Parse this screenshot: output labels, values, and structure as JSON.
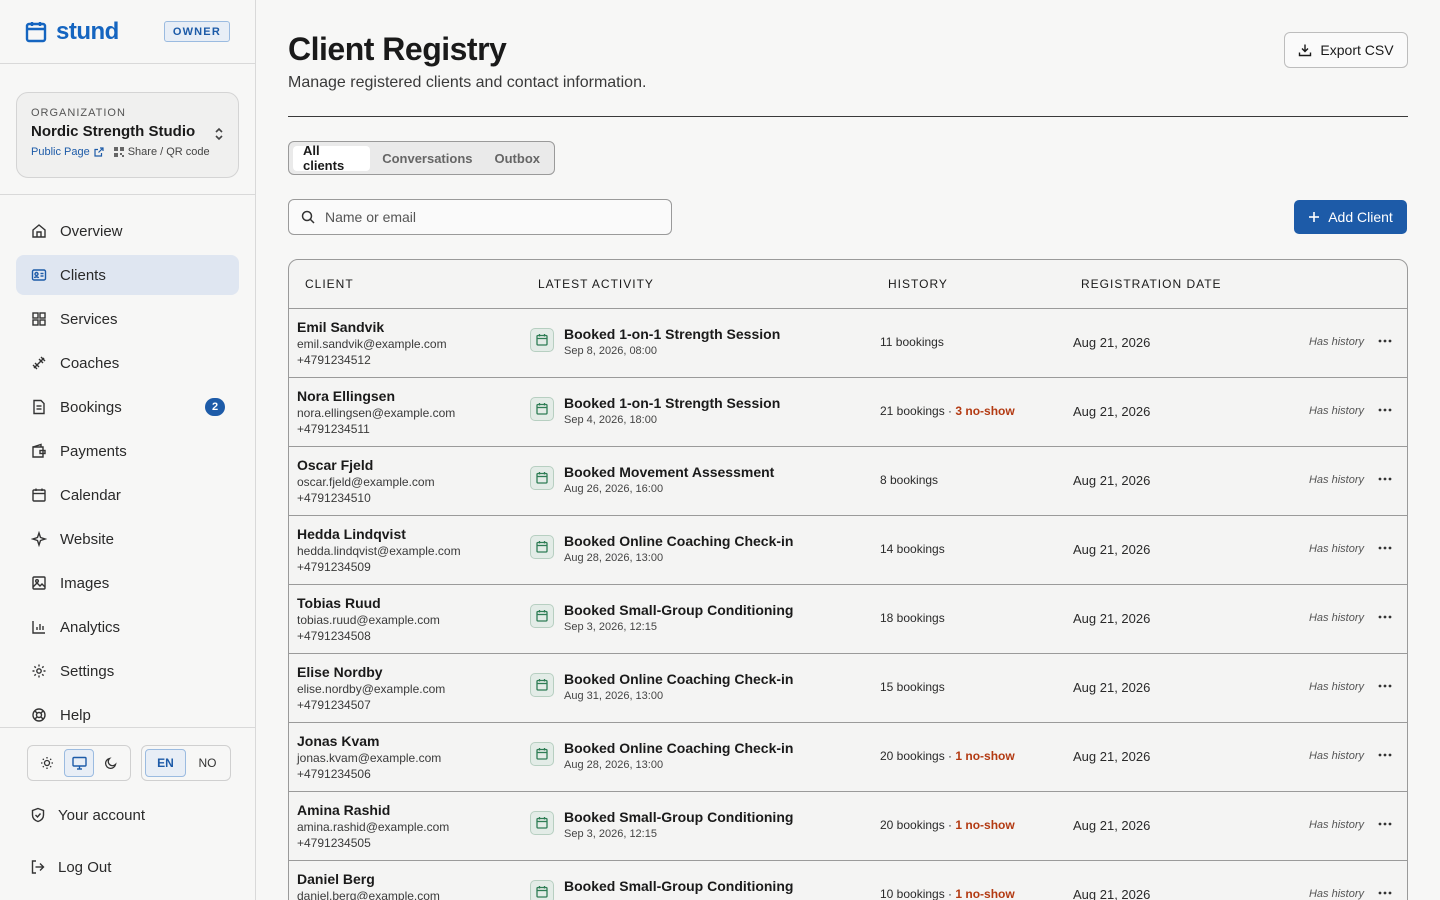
{
  "brand": {
    "name": "stund",
    "role_badge": "OWNER"
  },
  "organization": {
    "caption": "ORGANIZATION",
    "name": "Nordic Strength Studio",
    "public_page": "Public Page",
    "share": "Share / QR code"
  },
  "nav": [
    {
      "label": "Overview",
      "icon": "home-icon"
    },
    {
      "label": "Clients",
      "icon": "id-card-icon",
      "active": true
    },
    {
      "label": "Services",
      "icon": "grid-icon"
    },
    {
      "label": "Coaches",
      "icon": "dumbbell-icon"
    },
    {
      "label": "Bookings",
      "icon": "document-icon",
      "badge": "2"
    },
    {
      "label": "Payments",
      "icon": "wallet-icon"
    },
    {
      "label": "Calendar",
      "icon": "calendar-icon"
    },
    {
      "label": "Website",
      "icon": "sparkle-icon"
    },
    {
      "label": "Images",
      "icon": "image-icon"
    },
    {
      "label": "Analytics",
      "icon": "bar-chart-icon"
    },
    {
      "label": "Settings",
      "icon": "gear-icon"
    },
    {
      "label": "Help",
      "icon": "lifebuoy-icon"
    }
  ],
  "toggles": {
    "theme_active": "system",
    "lang": [
      "EN",
      "NO"
    ],
    "lang_active": "EN"
  },
  "bottom": {
    "account": "Your account",
    "logout": "Log Out"
  },
  "header": {
    "title": "Client Registry",
    "subtitle": "Manage registered clients and contact information.",
    "export": "Export CSV"
  },
  "tabs": [
    "All clients",
    "Conversations",
    "Outbox"
  ],
  "search": {
    "placeholder": "Name or email"
  },
  "add_client": "Add Client",
  "table": {
    "headers": [
      "CLIENT",
      "LATEST ACTIVITY",
      "HISTORY",
      "REGISTRATION DATE"
    ],
    "rows": [
      {
        "name": "Emil Sandvik",
        "email": "emil.sandvik@example.com",
        "phone": "+4791234512",
        "activity": "Booked 1-on-1 Strength Session",
        "time": "Sep 8, 2026, 08:00",
        "history": "11 bookings",
        "noshow": "",
        "date": "Aug 21, 2026",
        "status": "Has history"
      },
      {
        "name": "Nora Ellingsen",
        "email": "nora.ellingsen@example.com",
        "phone": "+4791234511",
        "activity": "Booked 1-on-1 Strength Session",
        "time": "Sep 4, 2026, 18:00",
        "history": "21 bookings",
        "noshow": "3 no-show",
        "date": "Aug 21, 2026",
        "status": "Has history"
      },
      {
        "name": "Oscar Fjeld",
        "email": "oscar.fjeld@example.com",
        "phone": "+4791234510",
        "activity": "Booked Movement Assessment",
        "time": "Aug 26, 2026, 16:00",
        "history": "8 bookings",
        "noshow": "",
        "date": "Aug 21, 2026",
        "status": "Has history"
      },
      {
        "name": "Hedda Lindqvist",
        "email": "hedda.lindqvist@example.com",
        "phone": "+4791234509",
        "activity": "Booked Online Coaching Check-in",
        "time": "Aug 28, 2026, 13:00",
        "history": "14 bookings",
        "noshow": "",
        "date": "Aug 21, 2026",
        "status": "Has history"
      },
      {
        "name": "Tobias Ruud",
        "email": "tobias.ruud@example.com",
        "phone": "+4791234508",
        "activity": "Booked Small-Group Conditioning",
        "time": "Sep 3, 2026, 12:15",
        "history": "18 bookings",
        "noshow": "",
        "date": "Aug 21, 2026",
        "status": "Has history"
      },
      {
        "name": "Elise Nordby",
        "email": "elise.nordby@example.com",
        "phone": "+4791234507",
        "activity": "Booked Online Coaching Check-in",
        "time": "Aug 31, 2026, 13:00",
        "history": "15 bookings",
        "noshow": "",
        "date": "Aug 21, 2026",
        "status": "Has history"
      },
      {
        "name": "Jonas Kvam",
        "email": "jonas.kvam@example.com",
        "phone": "+4791234506",
        "activity": "Booked Online Coaching Check-in",
        "time": "Aug 28, 2026, 13:00",
        "history": "20 bookings",
        "noshow": "1 no-show",
        "date": "Aug 21, 2026",
        "status": "Has history"
      },
      {
        "name": "Amina Rashid",
        "email": "amina.rashid@example.com",
        "phone": "+4791234505",
        "activity": "Booked Small-Group Conditioning",
        "time": "Sep 3, 2026, 12:15",
        "history": "20 bookings",
        "noshow": "1 no-show",
        "date": "Aug 21, 2026",
        "status": "Has history"
      },
      {
        "name": "Daniel Berg",
        "email": "daniel.berg@example.com",
        "phone": "",
        "activity": "Booked Small-Group Conditioning",
        "time": "",
        "history": "10 bookings",
        "noshow": "1 no-show",
        "date": "Aug 21, 2026",
        "status": "Has history"
      }
    ]
  },
  "colors": {
    "accent": "#1d5ba8",
    "noshow": "#b33a12",
    "activity_icon": "#2e7d55"
  }
}
